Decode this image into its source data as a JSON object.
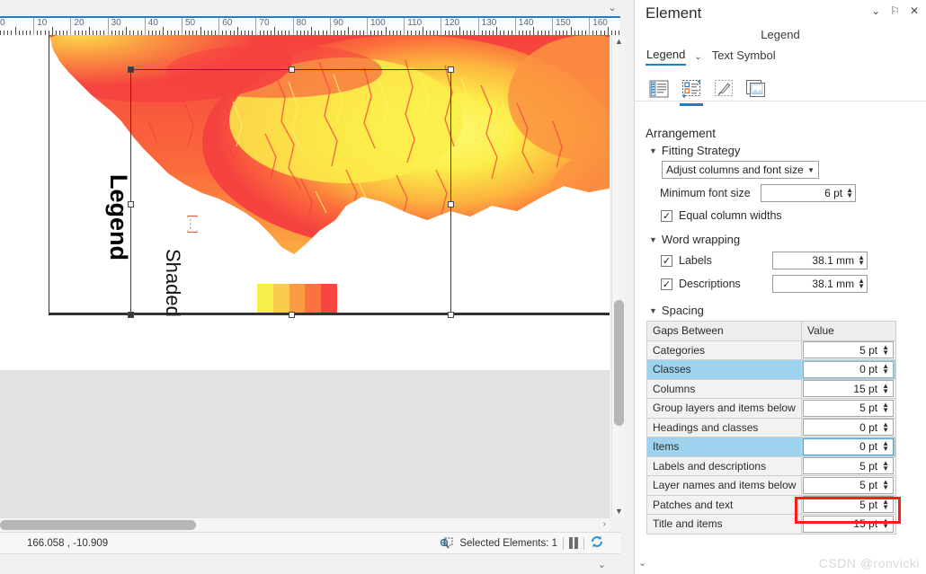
{
  "app": {
    "status": {
      "coordinates": "166.058 , -10.909",
      "selected_elements": "Selected Elements: 1",
      "pause_icon": "pause-icon",
      "refresh_icon": "refresh-icon",
      "selection_icon": "select-elements-icon"
    },
    "watermark": "CSDN @ronvicki"
  },
  "ruler": {
    "unit_labels": [
      "0",
      "10",
      "20",
      "30",
      "40",
      "50",
      "60",
      "70",
      "80",
      "90",
      "100",
      "110",
      "120",
      "130",
      "140",
      "150",
      "160"
    ],
    "accent_color": "#1b80c4"
  },
  "layout_view": {
    "legend_element": {
      "title": "Legend",
      "layer_label": "Shaded",
      "continuation": "[...]",
      "swatch_colors": [
        "#f7f04a",
        "#fbcb4b",
        "#fb9b42",
        "#fb713f",
        "#f8453f"
      ]
    }
  },
  "panel": {
    "title": "Element",
    "subtitle": "Legend",
    "header_buttons": [
      {
        "name": "menu-chevron-icon",
        "glyph": "⌄"
      },
      {
        "name": "pin-icon",
        "glyph": "⚐"
      },
      {
        "name": "close-icon",
        "glyph": "✕"
      }
    ],
    "tabs": [
      {
        "label": "Legend",
        "active": true
      },
      {
        "label": "Text Symbol",
        "active": false
      }
    ],
    "tab_caret": "⌄",
    "icon_buttons": [
      {
        "name": "legend-items-icon",
        "selected": false
      },
      {
        "name": "legend-arrangement-icon",
        "selected": true
      },
      {
        "name": "legend-format-icon",
        "selected": false
      },
      {
        "name": "legend-frame-icon",
        "selected": false
      }
    ],
    "arrangement": {
      "heading": "Arrangement",
      "fitting_strategy": {
        "heading": "Fitting Strategy",
        "strategy_value": "Adjust columns and font size",
        "min_font_label": "Minimum font size",
        "min_font_value": "6 pt",
        "equal_columns_label": "Equal column widths",
        "equal_columns_checked": true
      },
      "word_wrapping": {
        "heading": "Word wrapping",
        "rows": [
          {
            "label": "Labels",
            "checked": true,
            "value": "38.1 mm"
          },
          {
            "label": "Descriptions",
            "checked": true,
            "value": "38.1 mm"
          }
        ]
      },
      "spacing": {
        "heading": "Spacing",
        "columns": [
          "Gaps Between",
          "Value"
        ],
        "rows": [
          {
            "name": "Categories",
            "value": "5 pt",
            "selected": false,
            "focused": false
          },
          {
            "name": "Classes",
            "value": "0 pt",
            "selected": true,
            "focused": false
          },
          {
            "name": "Columns",
            "value": "15 pt",
            "selected": false,
            "focused": false
          },
          {
            "name": "Group layers and items below",
            "value": "5 pt",
            "selected": false,
            "focused": false
          },
          {
            "name": "Headings and classes",
            "value": "0 pt",
            "selected": false,
            "focused": false
          },
          {
            "name": "Items",
            "value": "0 pt",
            "selected": true,
            "focused": true
          },
          {
            "name": "Labels and descriptions",
            "value": "5 pt",
            "selected": false,
            "focused": false
          },
          {
            "name": "Layer names and items below",
            "value": "5 pt",
            "selected": false,
            "focused": false
          },
          {
            "name": "Patches and text",
            "value": "5 pt",
            "selected": false,
            "focused": false
          },
          {
            "name": "Title and items",
            "value": "15 pt",
            "selected": false,
            "focused": false
          }
        ],
        "highlight_color": "#fb1f17",
        "highlighted_row": "Classes"
      }
    }
  }
}
